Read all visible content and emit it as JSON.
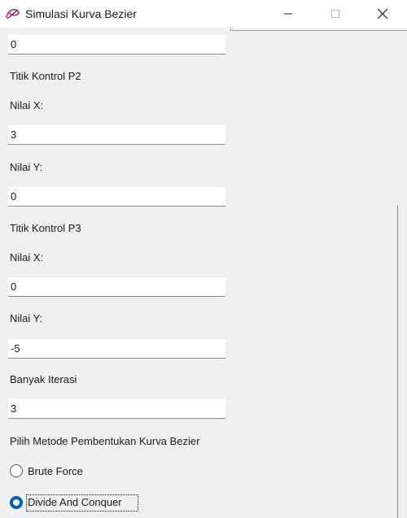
{
  "window": {
    "title": "Simulasi Kurva Bezier",
    "icon": "bezier-curve-app-icon",
    "controls": [
      "minimize-icon",
      "maximize-icon",
      "close-icon"
    ]
  },
  "form": {
    "p1_y_value": "0",
    "p2": {
      "heading": "Titik Kontrol P2",
      "x_label": "Nilai X:",
      "x_value": "3",
      "y_label": "Nilai Y:",
      "y_value": "0"
    },
    "p3": {
      "heading": "Titik Kontrol P3",
      "x_label": "Nilai X:",
      "x_value": "0",
      "y_label": "Nilai Y:",
      "y_value": "-5"
    },
    "iterations": {
      "label": "Banyak Iterasi",
      "value": "3"
    },
    "method": {
      "label": "Pilih Metode Pembentukan Kurva Bezier",
      "options": [
        {
          "label": "Brute Force",
          "selected": false
        },
        {
          "label": "Divide And Conquer",
          "selected": true
        }
      ],
      "accent_color": "#005fb8"
    }
  }
}
